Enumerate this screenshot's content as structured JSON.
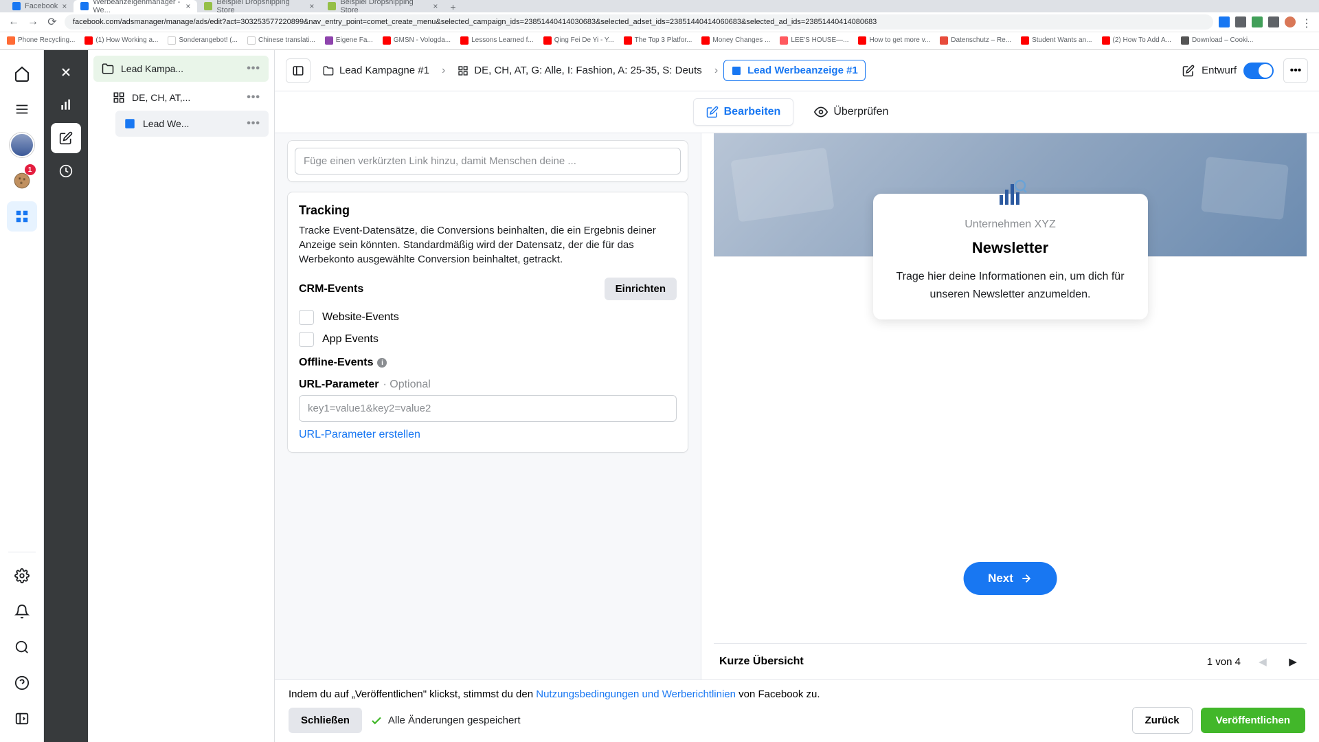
{
  "browser": {
    "tabs": [
      {
        "title": "Facebook",
        "active": false,
        "favicon": "fb"
      },
      {
        "title": "Werbeanzeigenmanager - We...",
        "active": true,
        "favicon": "fb"
      },
      {
        "title": "Beispiel Dropshipping Store",
        "active": false,
        "favicon": "shopify"
      },
      {
        "title": "Beispiel Dropshipping Store",
        "active": false,
        "favicon": "shopify"
      }
    ],
    "url": "facebook.com/adsmanager/manage/ads/edit?act=303253577220899&nav_entry_point=comet_create_menu&selected_campaign_ids=23851440414030683&selected_adset_ids=23851440414060683&selected_ad_ids=23851440414080683",
    "bookmarks": [
      "Phone Recycling...",
      "(1) How Working a...",
      "Sonderangebot! (...",
      "Chinese translati...",
      "Eigene Fa...",
      "GMSN - Vologda...",
      "Lessons Learned f...",
      "Qing Fei De Yi - Y...",
      "The Top 3 Platfor...",
      "Money Changes ...",
      "LEE'S HOUSE—...",
      "How to get more v...",
      "Datenschutz – Re...",
      "Student Wants an...",
      "(2) How To Add A...",
      "Download – Cooki..."
    ]
  },
  "rail": {
    "badge": "1"
  },
  "tree": {
    "campaign": "Lead Kampa...",
    "adset": "DE, CH, AT,...",
    "ad": "Lead We..."
  },
  "breadcrumb": {
    "campaign": "Lead Kampagne #1",
    "adset": "DE, CH, AT, G: Alle, I: Fashion, A: 25-35, S: Deuts",
    "ad": "Lead Werbeanzeige #1",
    "status": "Entwurf"
  },
  "modes": {
    "edit": "Bearbeiten",
    "review": "Überprüfen"
  },
  "form": {
    "link_placeholder": "Füge einen verkürzten Link hinzu, damit Menschen deine ...",
    "tracking_heading": "Tracking",
    "tracking_desc": "Tracke Event-Datensätze, die Conversions beinhalten, die ein Ergebnis deiner Anzeige sein könnten. Standardmäßig wird der Datensatz, der die für das Werbekonto ausgewählte Conversion beinhaltet, getrackt.",
    "crm_label": "CRM-Events",
    "crm_button": "Einrichten",
    "website_events": "Website-Events",
    "app_events": "App Events",
    "offline_events": "Offline-Events",
    "url_param_label": "URL-Parameter",
    "url_param_optional": "· Optional",
    "url_param_placeholder": "key1=value1&key2=value2",
    "url_param_link": "URL-Parameter erstellen"
  },
  "preview": {
    "company": "Unternehmen XYZ",
    "title": "Newsletter",
    "body": "Trage hier deine Informationen ein, um dich für unseren Newsletter anzumelden.",
    "next": "Next",
    "overview_label": "Kurze Übersicht",
    "pager": "1 von 4"
  },
  "footer": {
    "disclaimer_pre": "Indem du auf „Veröffentlichen\" klickst, stimmst du den ",
    "disclaimer_link": "Nutzungsbedingungen und Werberichtlinien",
    "disclaimer_post": " von Facebook zu.",
    "close": "Schließen",
    "saved": "Alle Änderungen gespeichert",
    "back": "Zurück",
    "publish": "Veröffentlichen"
  }
}
